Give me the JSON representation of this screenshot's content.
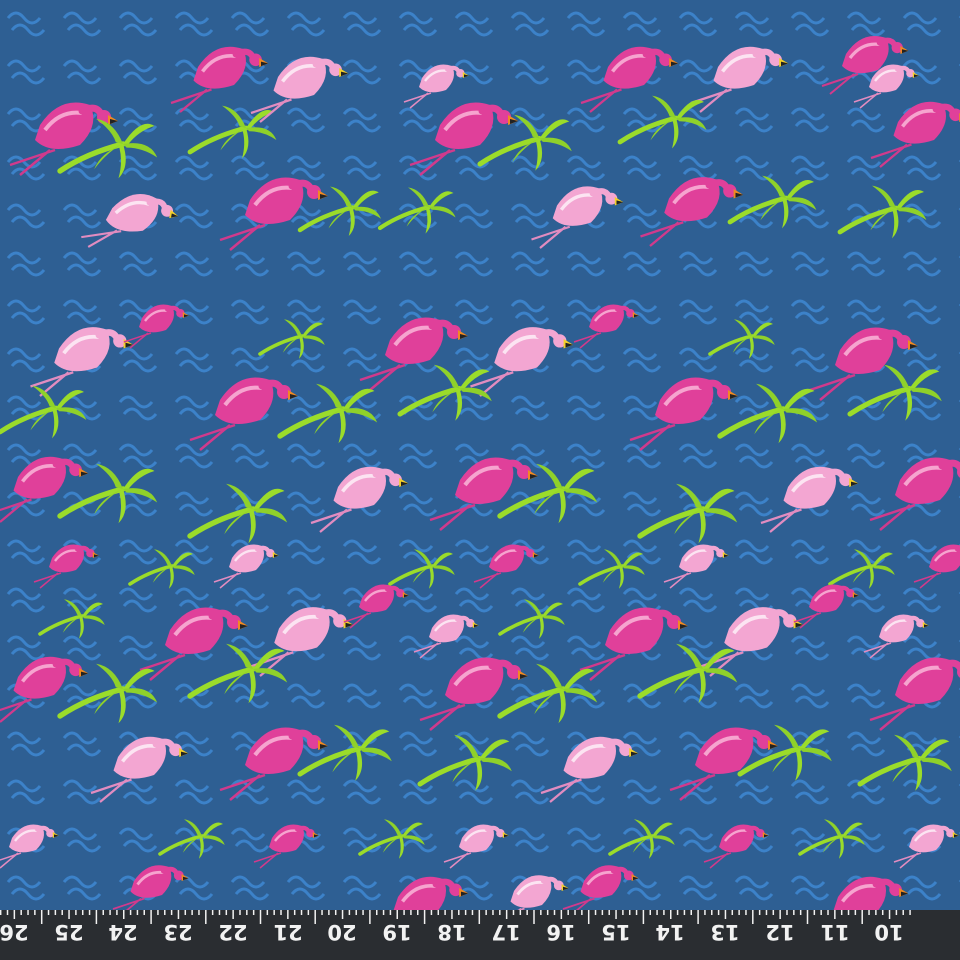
{
  "fabric": {
    "background_color": "#2e5f93",
    "wave_color": "#3f88d3",
    "palm_color": "#9bdc2a",
    "flamingo_hot_pink": "#e0409a",
    "flamingo_light_pink": "#f3a6d2",
    "beak_color": "#f08a20"
  },
  "ruler": {
    "background_color": "#2a2d31",
    "text_color": "#f2f2f2",
    "numbers": [
      "26",
      "25",
      "24",
      "23",
      "22",
      "21",
      "20",
      "19",
      "18",
      "17",
      "16",
      "15",
      "14",
      "13",
      "12",
      "11",
      "10"
    ]
  }
}
